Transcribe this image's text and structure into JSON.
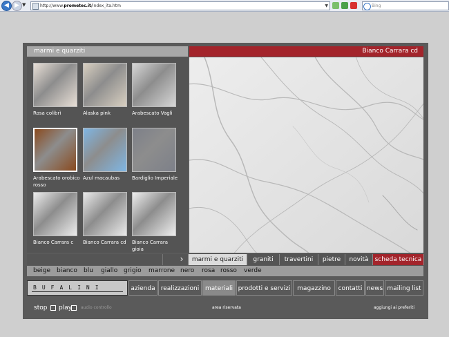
{
  "browser": {
    "url_prefix": "http://www.",
    "url_domain": "prometec.it",
    "url_path": "/index_ita.htm",
    "search_placeholder": "Bing"
  },
  "gallery": {
    "heading": "marmi e quarziti",
    "items": [
      {
        "label": "Rosa colibrì",
        "color": "#e8dfd6"
      },
      {
        "label": "Alaska pink",
        "color": "#d8cfc0"
      },
      {
        "label": "Arabescato Vagli",
        "color": "#d6d6d6"
      },
      {
        "label": "Arabescato orobico rosso",
        "color": "#8a4a1e"
      },
      {
        "label": "Azul macaubas",
        "color": "#7fb6e4"
      },
      {
        "label": "Bardiglio Imperiale",
        "color": "#7d8089"
      },
      {
        "label": "Bianco Carrara c",
        "color": "#ececec"
      },
      {
        "label": "Bianco Carrara cd",
        "color": "#eaeaea"
      },
      {
        "label": "Bianco Carrara gioia",
        "color": "#eeeeee"
      }
    ]
  },
  "preview": {
    "title": "Bianco Carrara cd"
  },
  "category_tabs": [
    {
      "label": "marmi e quarziti",
      "active": true
    },
    {
      "label": "graniti"
    },
    {
      "label": "travertini"
    },
    {
      "label": "pietre"
    },
    {
      "label": "novità"
    },
    {
      "label": "scheda tecnica",
      "red": true
    }
  ],
  "next_arrow": "›",
  "colors": [
    "beige",
    "bianco",
    "blu",
    "giallo",
    "grigio",
    "marrone",
    "nero",
    "rosa",
    "rosso",
    "verde"
  ],
  "logo": "BUFALINI",
  "main_nav": [
    {
      "label": "azienda"
    },
    {
      "label": "realizzazioni"
    },
    {
      "label": "materiali",
      "active": true
    },
    {
      "label": "prodotti e servizi"
    },
    {
      "label": "magazzino"
    },
    {
      "label": "contatti"
    },
    {
      "label": "news"
    },
    {
      "label": "mailing list"
    }
  ],
  "footer": {
    "stop": "stop",
    "play": "play",
    "audio": "audio controllo",
    "reserved": "area riservata",
    "favorites": "aggiungi ai preferiti"
  },
  "theme": {
    "accent": "#a3242b",
    "frame": "#5a5a5a",
    "background": "#cfcfcf"
  }
}
